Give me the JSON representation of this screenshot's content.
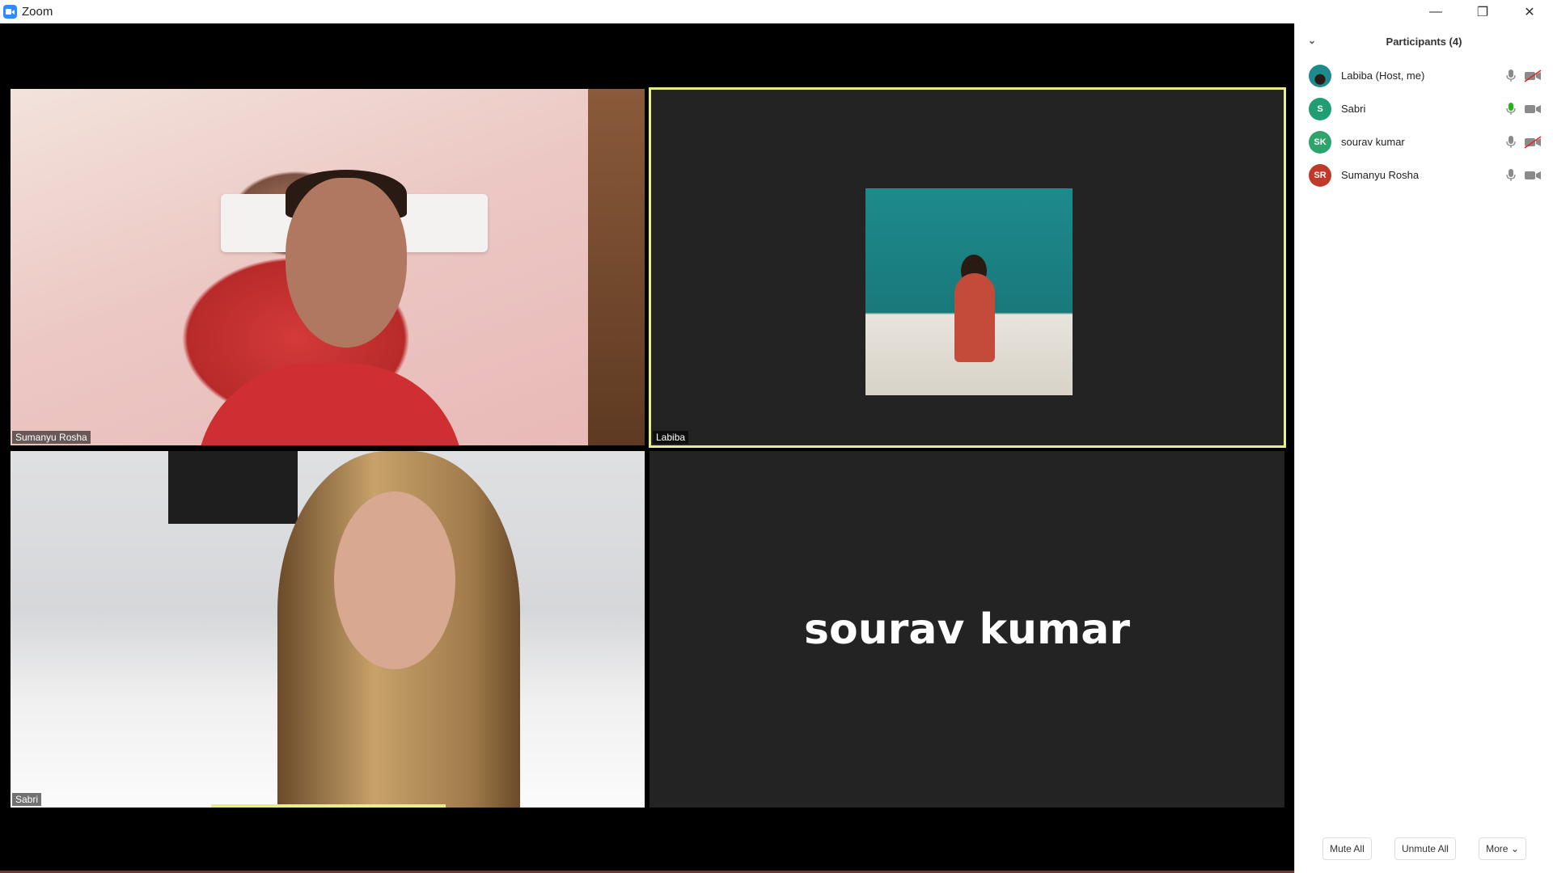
{
  "window": {
    "title": "Zoom"
  },
  "window_controls": {
    "minimize": "—",
    "restore": "❐",
    "close": "✕"
  },
  "tiles": {
    "sumanyu": {
      "name": "Sumanyu Rosha"
    },
    "labiba": {
      "name": "Labiba"
    },
    "sabri": {
      "name": "Sabri"
    },
    "sourav": {
      "name": "sourav kumar"
    }
  },
  "participants": {
    "title": "Participants (4)",
    "items": [
      {
        "name": "Labiba (Host, me)",
        "initials": "",
        "avatar_color": "#1e8a8c",
        "mic": "muted",
        "video": "off"
      },
      {
        "name": "Sabri",
        "initials": "S",
        "avatar_color": "#1e9e72",
        "mic": "speaking",
        "video": "on"
      },
      {
        "name": "sourav kumar",
        "initials": "SK",
        "avatar_color": "#2ea36b",
        "mic": "muted",
        "video": "off"
      },
      {
        "name": "Sumanyu Rosha",
        "initials": "SR",
        "avatar_color": "#c0392b",
        "mic": "muted",
        "video": "on"
      }
    ],
    "footer": {
      "mute_all": "Mute All",
      "unmute_all": "Unmute All",
      "more": "More ⌄"
    }
  },
  "colors": {
    "active_speaker": "#e8ec8c",
    "mic_on": "#1fb80f",
    "mic_off": "#8a8a8a",
    "video_off": "#e02828"
  }
}
